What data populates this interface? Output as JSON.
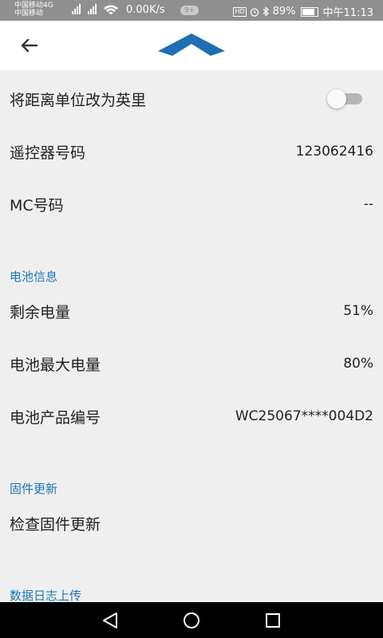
{
  "status_bar": {
    "carrier1": "中国移动4G",
    "carrier2": "中国移动",
    "net_speed": "0.00K/s",
    "notif_badge": "9+",
    "hd": "HD",
    "battery": "89%",
    "time": "中午11:13"
  },
  "settings": {
    "miles_toggle_label": "将距离单位改为英里",
    "miles_toggle_on": false,
    "remote_label": "遥控器号码",
    "remote_value": "123062416",
    "mc_label": "MC号码",
    "mc_value": "--"
  },
  "battery_section": {
    "title": "电池信息",
    "remaining_label": "剩余电量",
    "remaining_value": "51%",
    "max_label": "电池最大电量",
    "max_value": "80%",
    "serial_label": "电池产品编号",
    "serial_value": "WC25067****004D2"
  },
  "firmware_section": {
    "title": "固件更新",
    "check_label": "检查固件更新"
  },
  "log_section": {
    "title": "数据日志上传"
  },
  "colors": {
    "accent": "#1b78b3",
    "logo": "#1f6fb3",
    "background": "#efefef"
  },
  "icons": {
    "back": "arrow-left-icon",
    "nav_back": "triangle-back-icon",
    "nav_home": "circle-home-icon",
    "nav_recent": "square-recent-icon"
  }
}
